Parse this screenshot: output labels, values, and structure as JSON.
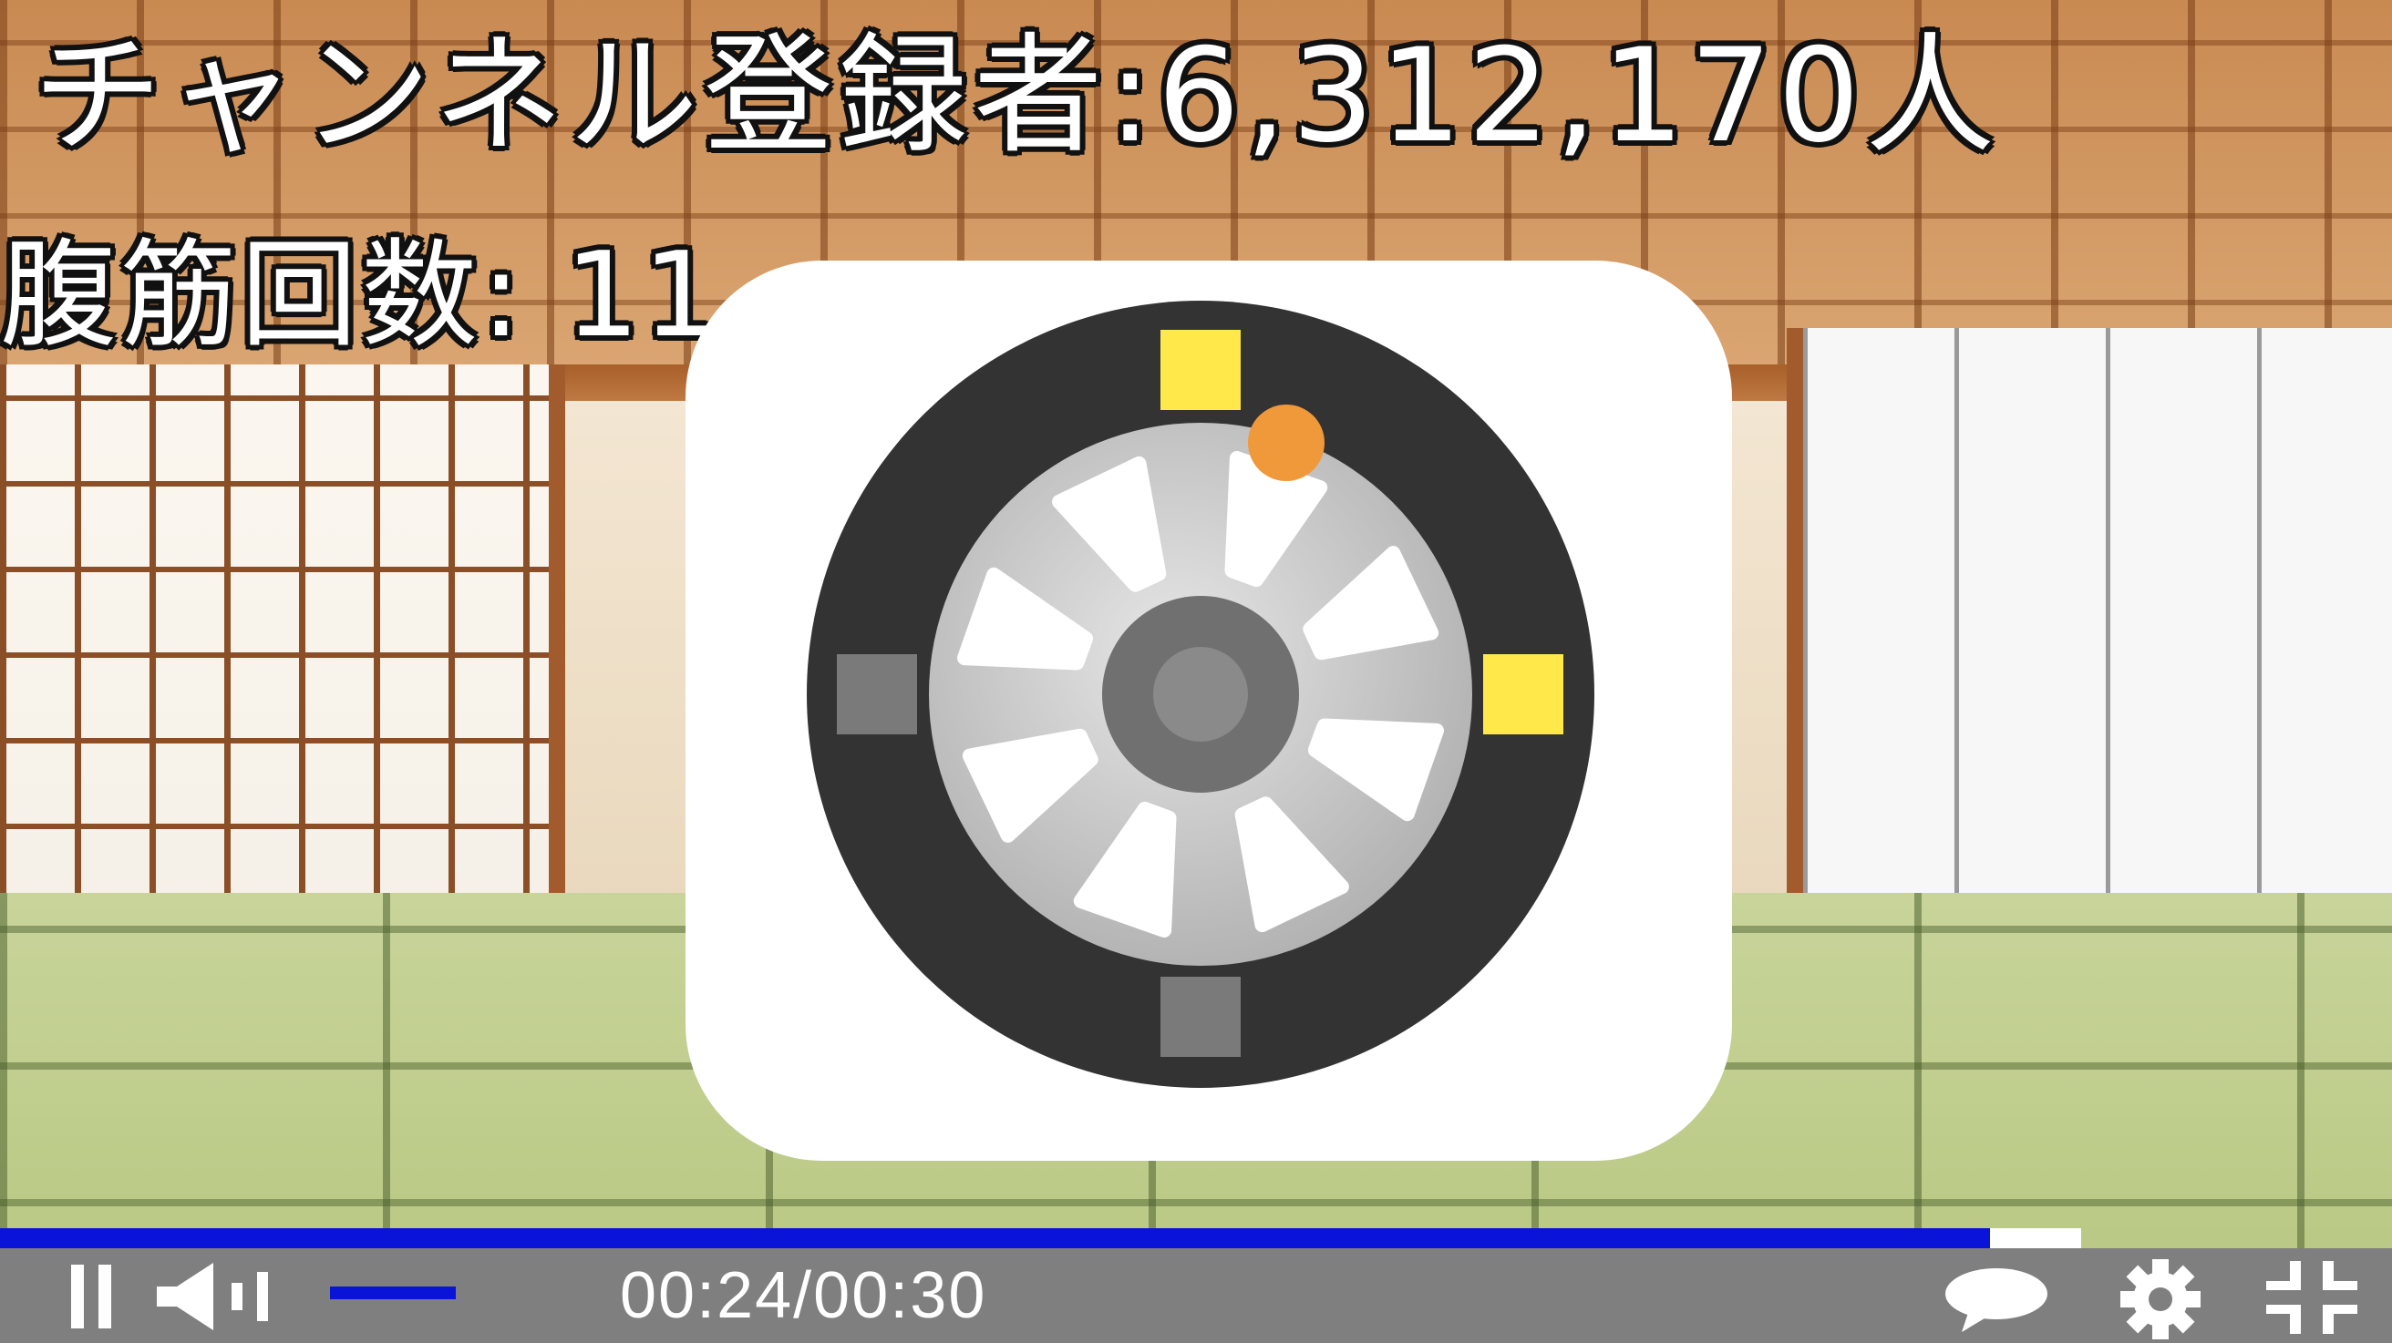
{
  "hud": {
    "subscribers_label": "チャンネル登録者:6,312,170人",
    "situps_label": "腹筋回数: 11"
  },
  "game": {
    "tire_color": "#333333",
    "rim_color": "#c4c4c4",
    "hub_color": "#707070",
    "active_marker_color": "#ffe94a",
    "inactive_marker_color": "#7a7a7a",
    "ball_color": "#f0993a"
  },
  "player": {
    "time_display": "00:24/00:30",
    "progress_fraction": 0.832,
    "buffer_fraction": 0.87,
    "volume_fraction": 0.59,
    "progress_color": "#0a14d8",
    "bar_color": "#7f7f7f",
    "icons": [
      "pause-icon",
      "volume-icon",
      "captions-icon",
      "gear-icon",
      "exit-fullscreen-icon"
    ]
  }
}
